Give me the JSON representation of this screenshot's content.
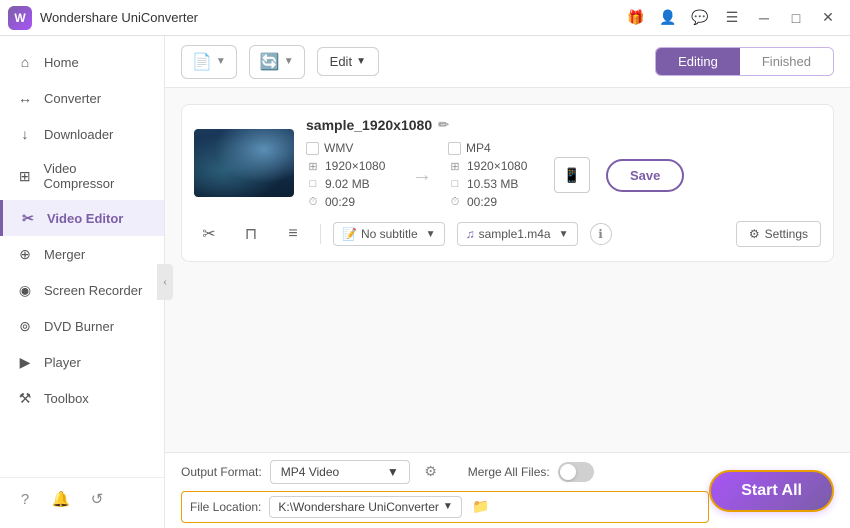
{
  "app": {
    "title": "Wondershare UniConverter",
    "logo_letter": "W"
  },
  "titlebar": {
    "gift_icon": "🎁",
    "controls": [
      "menu_icon",
      "minimize",
      "maximize",
      "close"
    ]
  },
  "sidebar": {
    "items": [
      {
        "id": "home",
        "label": "Home",
        "icon": "⌂"
      },
      {
        "id": "converter",
        "label": "Converter",
        "icon": "↔"
      },
      {
        "id": "downloader",
        "label": "Downloader",
        "icon": "↓"
      },
      {
        "id": "video-compressor",
        "label": "Video Compressor",
        "icon": "⊞"
      },
      {
        "id": "video-editor",
        "label": "Video Editor",
        "icon": "✂",
        "active": true
      },
      {
        "id": "merger",
        "label": "Merger",
        "icon": "⊕"
      },
      {
        "id": "screen-recorder",
        "label": "Screen Recorder",
        "icon": "◉"
      },
      {
        "id": "dvd-burner",
        "label": "DVD Burner",
        "icon": "⊚"
      },
      {
        "id": "player",
        "label": "Player",
        "icon": "▶"
      },
      {
        "id": "toolbox",
        "label": "Toolbox",
        "icon": "⚒"
      }
    ],
    "footer_icons": [
      "?",
      "🔔",
      "↺"
    ]
  },
  "toolbar": {
    "add_btn_label": "",
    "add_icon": "+",
    "convert_btn_label": "",
    "edit_label": "Edit",
    "tabs": [
      {
        "id": "editing",
        "label": "Editing",
        "active": true
      },
      {
        "id": "finished",
        "label": "Finished",
        "active": false
      }
    ]
  },
  "video_item": {
    "name": "sample_1920x1080",
    "source": {
      "format": "WMV",
      "resolution": "1920×1080",
      "size": "9.02 MB",
      "duration": "00:29"
    },
    "output": {
      "format": "MP4",
      "resolution": "1920×1080",
      "size": "10.53 MB",
      "duration": "00:29"
    },
    "save_btn": "Save",
    "subtitle_placeholder": "No subtitle",
    "audio_track": "sample1.m4a",
    "settings_btn": "Settings"
  },
  "bottom_bar": {
    "output_format_label": "Output Format:",
    "output_format_value": "MP4 Video",
    "merge_label": "Merge All Files:",
    "file_location_label": "File Location:",
    "file_path": "K:\\Wondershare UniConverter",
    "start_all_btn": "Start All"
  }
}
